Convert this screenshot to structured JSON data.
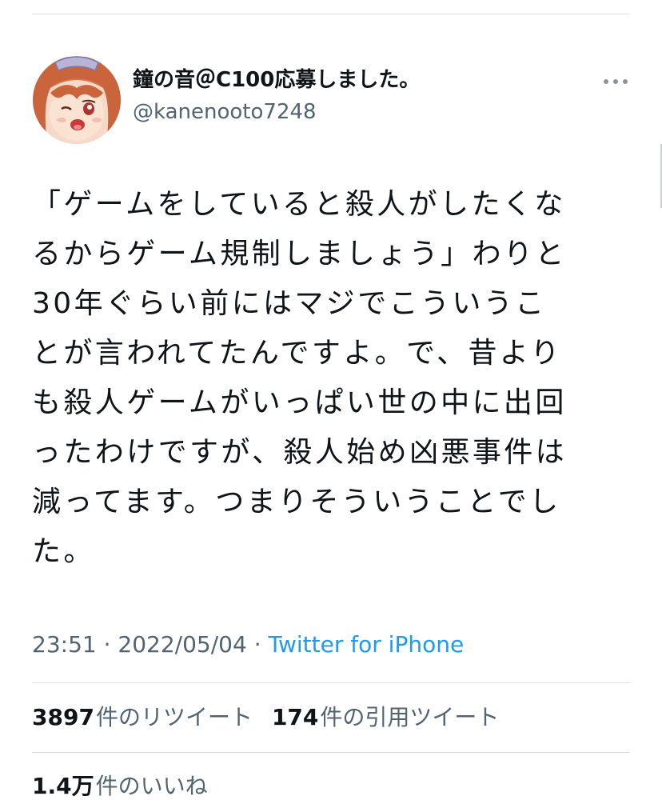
{
  "tweet": {
    "display_name": "鐘の音＠C100応募しました。",
    "handle": "@kanenooto7248",
    "text_lines": [
      "「ゲームをしていると殺人がしたくな",
      "るからゲーム規制しましょう」わりと",
      "30年ぐらい前にはマジでこういうこ",
      "とが言われてたんですよ。で、昔より",
      "も殺人ゲームがいっぱい世の中に出回",
      "ったわけですが、殺人始め凶悪事件は",
      "減ってます。つまりそういうことでし",
      "た。"
    ],
    "time": "23:51",
    "separator": "·",
    "date": "2022/05/04",
    "source": "Twitter for iPhone"
  },
  "stats": {
    "retweets_count": "3897",
    "retweets_label": "件のリツイート",
    "quotes_count": "174",
    "quotes_label": "件の引用ツイート",
    "likes_count": "1.4万",
    "likes_label": "件のいいね"
  },
  "icons": {
    "more": "more-horizontal-icon"
  },
  "colors": {
    "link": "#1d9bf0",
    "secondary_text": "#536471",
    "divider": "#dcdfe3"
  }
}
